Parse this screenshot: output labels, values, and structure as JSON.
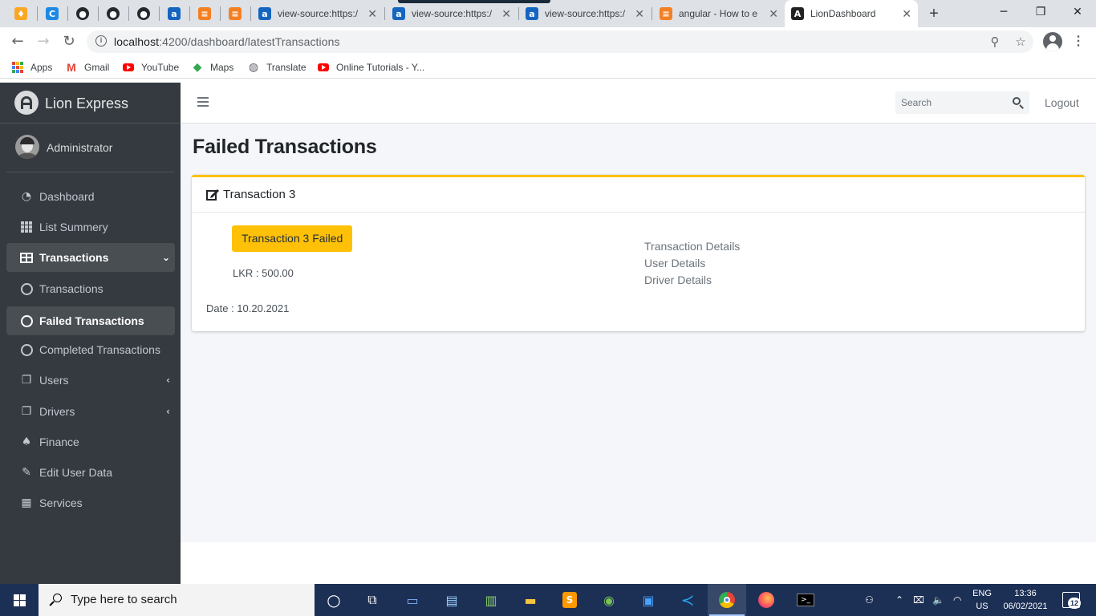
{
  "browser": {
    "tabs": [
      {
        "title": "view-source:https:/",
        "favicon": "a-icon"
      },
      {
        "title": "view-source:https:/",
        "favicon": "a-icon"
      },
      {
        "title": "view-source:https:/",
        "favicon": "a-icon"
      },
      {
        "title": "angular - How to e",
        "favicon": "stackoverflow-icon"
      },
      {
        "title": "LionDashboard",
        "favicon": "angular-icon",
        "active": true
      }
    ],
    "url_host": "localhost",
    "url_rest": ":4200/dashboard/latestTransactions",
    "bookmarks": [
      {
        "label": "Apps",
        "icon": "apps-grid-icon"
      },
      {
        "label": "Gmail",
        "icon": "gmail-icon"
      },
      {
        "label": "YouTube",
        "icon": "youtube-icon"
      },
      {
        "label": "Maps",
        "icon": "maps-icon"
      },
      {
        "label": "Translate",
        "icon": "translate-icon"
      },
      {
        "label": "Online Tutorials - Y...",
        "icon": "youtube-icon"
      }
    ]
  },
  "app": {
    "brand": "Lion Express",
    "user": "Administrator",
    "sidebar": [
      {
        "label": "Dashboard",
        "icon": "tachometer-icon"
      },
      {
        "label": "List Summery",
        "icon": "th-grid-icon"
      },
      {
        "label": "Transactions",
        "icon": "table-icon",
        "open": true
      },
      {
        "label": "Transactions",
        "icon": "circle-icon"
      },
      {
        "label": "Failed Transactions",
        "icon": "circle-icon",
        "active": true
      },
      {
        "label": "Completed Transactions",
        "icon": "circle-icon"
      },
      {
        "label": "Users",
        "icon": "copy-icon"
      },
      {
        "label": "Drivers",
        "icon": "copy-icon"
      },
      {
        "label": "Finance",
        "icon": "tree-icon"
      },
      {
        "label": "Edit User Data",
        "icon": "edit-icon"
      },
      {
        "label": "Services",
        "icon": "calendar-icon"
      }
    ],
    "search_placeholder": "Search",
    "logout": "Logout",
    "page_title": "Failed Transactions",
    "card": {
      "title": "Transaction 3",
      "status_button": "Transaction 3 Failed",
      "amount": "LKR : 500.00",
      "date": "Date : 10.20.2021",
      "links": [
        "Transaction Details",
        "User Details",
        "Driver Details"
      ]
    },
    "colors": {
      "sidebar_bg": "#343a40",
      "accent": "#ffc107",
      "content_bg": "#f4f6f9"
    }
  },
  "taskbar": {
    "search_placeholder": "Type here to search",
    "lang_top": "ENG",
    "lang_bottom": "US",
    "time": "13:36",
    "date": "06/02/2021",
    "notifications": "12"
  }
}
